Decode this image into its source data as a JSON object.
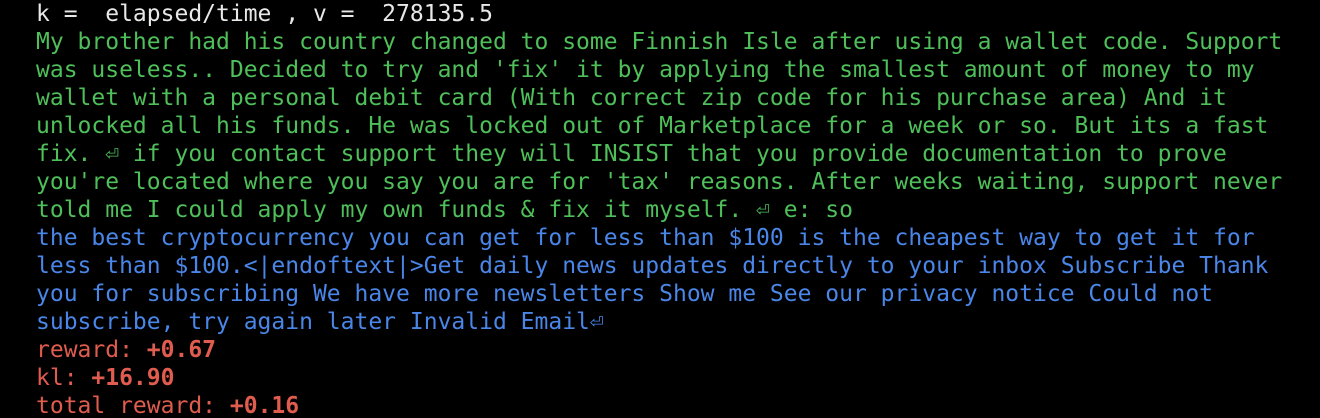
{
  "header": {
    "text": "k =  elapsed/time , v =  278135.5"
  },
  "colors": {
    "background": "#000000",
    "header": "#e8e8e8",
    "prompt": "#4fbf5a",
    "completion": "#4a86e8",
    "stats": "#e05c4f"
  },
  "prompt_lines": [
    "My brother had his country changed to some Finnish Isle after using a wallet code. Support",
    "was useless.. Decided to try and 'fix' it by applying the smallest amount of money to my",
    "wallet with a personal debit card (With correct zip code for his purchase area) And it",
    "unlocked all his funds. He was locked out of Marketplace for a week or so. But its a fast",
    "fix. ⏎ if you contact support they will INSIST that you provide documentation to prove",
    "you're located where you say you are for 'tax' reasons. After weeks waiting, support never",
    "told me I could apply my own funds & fix it myself. ⏎ e: so"
  ],
  "completion_lines": [
    " the best cryptocurrency you can get for less than $100 is the cheapest way to get it for",
    "less than $100.<|endoftext|>Get daily news updates directly to your inbox Subscribe Thank",
    "you for subscribing We have more newsletters Show me See our privacy notice Could not",
    "subscribe, try again later Invalid Email⏎"
  ],
  "stats": {
    "reward_label": "reward: ",
    "reward_value": "+0.67",
    "kl_label": "kl: ",
    "kl_value": "+16.90",
    "total_label": "total reward: ",
    "total_value": "+0.16"
  }
}
